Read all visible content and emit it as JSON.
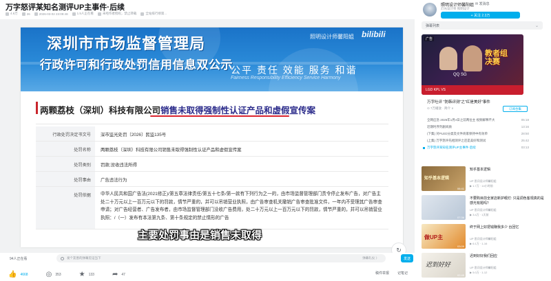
{
  "video": {
    "title": "万字怒评某知名测评UP主事件·后续",
    "meta": [
      {
        "icon": "view-icon",
        "text": "4.6万"
      },
      {
        "icon": "danmaku-icon",
        "text": "26"
      },
      {
        "icon": "clock-icon",
        "text": "2026-03-02 23:09:48"
      },
      {
        "icon": "person-icon",
        "text": "1.5人正在看"
      },
      {
        "icon": "no-icon",
        "text": "未经作者授权，禁止转载"
      },
      {
        "icon": "no-icon",
        "text": "全站排行榜第..."
      }
    ]
  },
  "frame": {
    "banner_title": "深圳市市场监督管理局",
    "banner_sub": "行政许可和行政处罚信用信息双公示",
    "motto": "公平 责任 效能 服务 和谐",
    "motto_en": "Fairness Responsibility Efficiency Service Harmony",
    "watermark": "照明设计师馨阳姐",
    "bili_logo": "bilibili",
    "heading_prefix": "两颗荔枝（深圳）科技有限公司",
    "heading_highlight": "销售未取得强制性认证产品和虚假宣传案",
    "rows": [
      {
        "k": "行政处罚决定书文号",
        "v": "深市监光处罚〔2026〕民监135号"
      },
      {
        "k": "处罚名称",
        "v": "两颗荔枝（深圳）科技有限公司销售未取得强制性认证产品和虚假宣传案"
      },
      {
        "k": "处罚类别",
        "v": "罚款;没收违法所得"
      },
      {
        "k": "处罚事由",
        "v": "广告违法行为"
      },
      {
        "k": "处罚依据",
        "v": "中华人民共和国广告法(2021修正)/第五章法律责任/第五十七条/第一款有下列行为之一的，由市场监督管理部门责令停止发布广告，对广告主处二十万元以上一百万元以下的罚款，情节严重的，并可以吊销营业执照，由广告审查机关撤销广告审查批准文件，一年内不受理其广告审查申请；对广告经营者、广告发布者，由市场监督管理部门没收广告费用，处二十万元以上一百万元以下的罚款，情节严重的，并可以吊销营业执照：/（一）发布有本法第九条、第十条规定的禁止情形的广告"
      }
    ],
    "subtitle": "主要处罚事由是销售未取得",
    "control_glyph": "↻"
  },
  "danmaku": {
    "viewers": "94人正在看",
    "placeholder": "发个友善的弹幕见证当下",
    "rules": "弹幕礼仪 〉",
    "send": "发送"
  },
  "actions": {
    "like": "4668",
    "coin": "353",
    "favorite": "133",
    "share": "47",
    "notes": "稿件举报",
    "more": "记笔记"
  },
  "sidebar": {
    "up_name": "照明设计师馨阳姐",
    "up_msg": "✉ 发消息",
    "up_desc": "灯光设计师 照明设计",
    "follow": "+ 关注 2.3万",
    "dm_list": "弹幕列表",
    "ad": {
      "tag": "广告",
      "big1": "教者组",
      "big2": "决赛",
      "teams": "QQ   SG",
      "foot": "LGD  KPL  VS"
    },
    "collection": {
      "title": "万字吐评 \"防韩评测\"之\"红是美好\"事件",
      "meta": "⊙ 7万播放 · 简介 ∨",
      "continue": "订阅合集"
    },
    "episodes": [
      {
        "title": "全网应急 2026年1月4日之前两位主 视频解释不大",
        "dur": "05:18",
        "active": false
      },
      {
        "title": "近期时序列剧阅质",
        "dur": "13:16",
        "active": false
      },
      {
        "title": "(下集) 对PLED分类及文件商家保持中有效单",
        "dur": "28:50",
        "active": false
      },
      {
        "title": "(上集) 万字怒评先相测评之还是美好和测试",
        "dur": "25:42",
        "active": false
      },
      {
        "title": "万字怒评某知名测评UP主事件·后续",
        "dur": "03:13",
        "active": true
      }
    ],
    "recs": [
      {
        "cls": "t1",
        "dur": "06:41",
        "title": "知乎基本逻辑",
        "by": "UP 思问设计师馨阳姐",
        "stat": "▶ 1.7万 · 14小时前"
      },
      {
        "cls": "t2",
        "dur": "07:36",
        "title": "不要购目前全家店新护眼灯: 只是调色客观真的是感光有题吗？",
        "by": "UP 思问设计师馨阳姐",
        "stat": "▶ 3.4万 · 1天前"
      },
      {
        "cls": "t3",
        "dur": "03:09",
        "title": "终于网上好把钱赚我多少 台回忆",
        "by": "UP 思问设计师馨阳姐",
        "stat": "▶ 6.1万 · 1-16"
      },
      {
        "cls": "t4",
        "dur": "02:45",
        "title": "迟到好好我们回应",
        "by": "UP 思问设计师馨阳姐",
        "stat": "▶ 5.0万 · 1-12"
      }
    ]
  }
}
